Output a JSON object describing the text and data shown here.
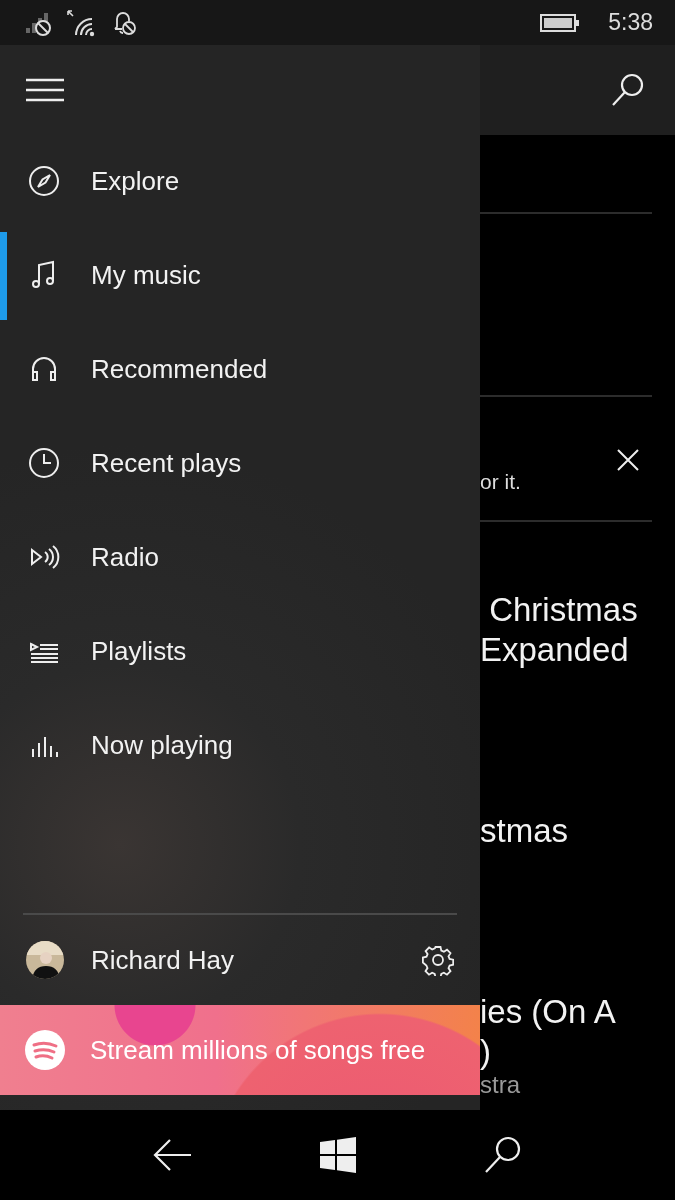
{
  "status_bar": {
    "time": "5:38"
  },
  "nav_items": [
    {
      "label": "Explore",
      "selected": false
    },
    {
      "label": "My music",
      "selected": true
    },
    {
      "label": "Recommended",
      "selected": false
    },
    {
      "label": "Recent plays",
      "selected": false
    },
    {
      "label": "Radio",
      "selected": false
    },
    {
      "label": "Playlists",
      "selected": false
    },
    {
      "label": "Now playing",
      "selected": false
    }
  ],
  "account": {
    "name": "Richard Hay"
  },
  "promo": {
    "text": "Stream millions of songs free"
  },
  "background": {
    "notice": "or it.",
    "lines": [
      {
        "text": " Christmas",
        "kind": "title"
      },
      {
        "text": "Expanded",
        "kind": "title-tight"
      },
      {
        "text": "stmas",
        "kind": "title-gap"
      },
      {
        "text": "ies (On A",
        "kind": "title-gap"
      },
      {
        "text": ")",
        "kind": "title-tight"
      },
      {
        "text": "stra",
        "kind": "subtitle"
      }
    ]
  }
}
